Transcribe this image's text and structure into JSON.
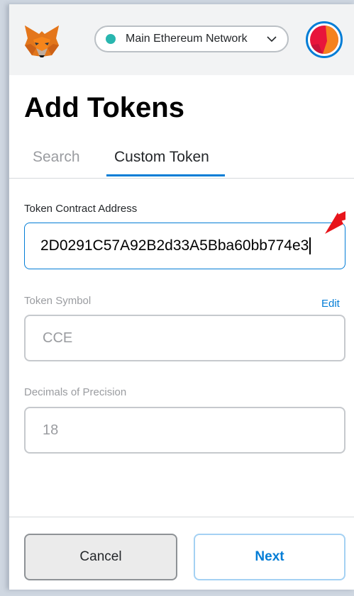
{
  "header": {
    "network": {
      "label": "Main Ethereum Network",
      "status_color": "#29b6af"
    },
    "account_icon": "identicon"
  },
  "page": {
    "title": "Add Tokens"
  },
  "tabs": [
    {
      "label": "Search",
      "active": false
    },
    {
      "label": "Custom Token",
      "active": true
    }
  ],
  "form": {
    "contract_address": {
      "label": "Token Contract Address",
      "value": "2D0291C57A92B2d33A5Bba60bb774e3"
    },
    "token_symbol": {
      "label": "Token Symbol",
      "edit_label": "Edit",
      "value": "CCE"
    },
    "decimals": {
      "label": "Decimals of Precision",
      "value": "18"
    }
  },
  "footer": {
    "cancel_label": "Cancel",
    "next_label": "Next"
  },
  "colors": {
    "accent": "#037dd6",
    "annotation_arrow": "#e8141b"
  }
}
